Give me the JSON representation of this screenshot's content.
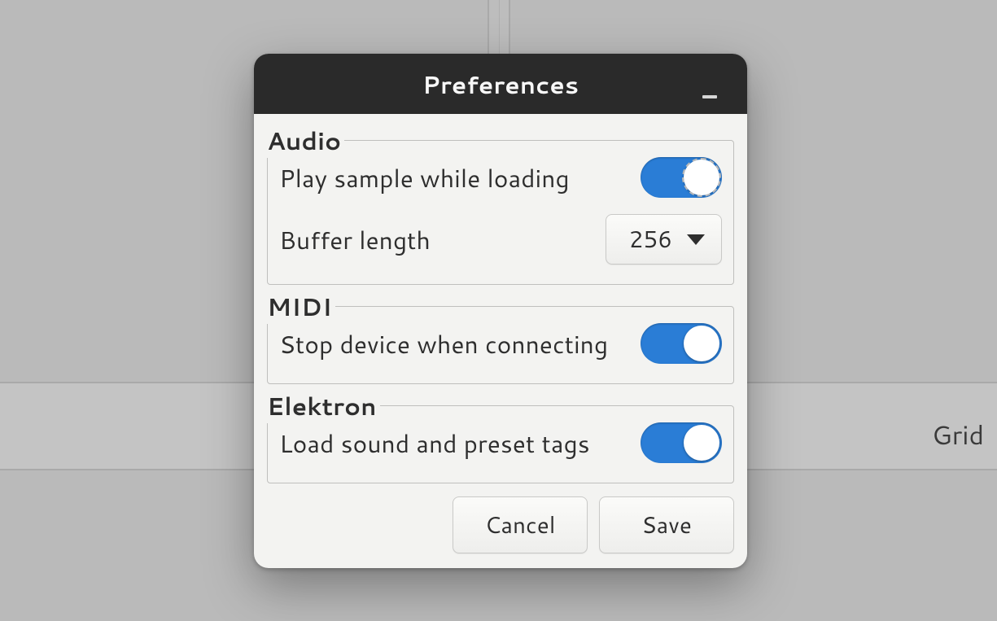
{
  "background": {
    "grid_label": "Grid"
  },
  "dialog": {
    "title": "Preferences",
    "sections": {
      "audio": {
        "legend": "Audio",
        "play_sample_label": "Play sample while loading",
        "play_sample_on": true,
        "buffer_label": "Buffer length",
        "buffer_value": "256"
      },
      "midi": {
        "legend": "MIDI",
        "stop_device_label": "Stop device when connecting",
        "stop_device_on": true
      },
      "elektron": {
        "legend": "Elektron",
        "load_tags_label": "Load sound and preset tags",
        "load_tags_on": true
      }
    },
    "buttons": {
      "cancel": "Cancel",
      "save": "Save"
    }
  }
}
